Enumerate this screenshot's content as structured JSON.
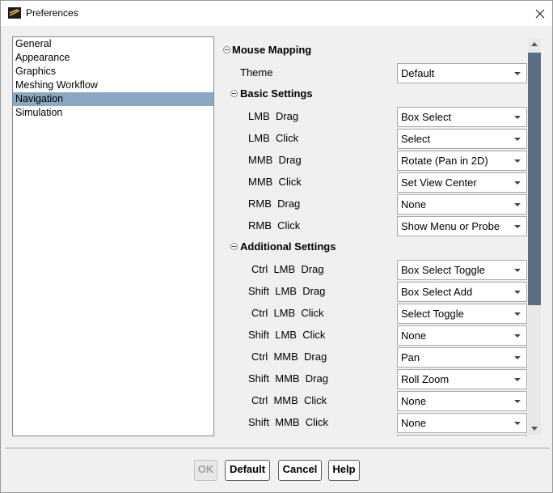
{
  "window": {
    "title": "Preferences"
  },
  "categories": [
    {
      "label": "General",
      "selected": false
    },
    {
      "label": "Appearance",
      "selected": false
    },
    {
      "label": "Graphics",
      "selected": false
    },
    {
      "label": "Meshing Workflow",
      "selected": false
    },
    {
      "label": "Navigation",
      "selected": true
    },
    {
      "label": "Simulation",
      "selected": false
    }
  ],
  "mouse_mapping": {
    "title": "Mouse Mapping",
    "theme_label": "Theme",
    "theme_value": "Default"
  },
  "basic_settings": {
    "title": "Basic Settings",
    "rows": [
      {
        "label": "LMB  Drag",
        "value": "Box Select"
      },
      {
        "label": "LMB  Click",
        "value": "Select"
      },
      {
        "label": "MMB  Drag",
        "value": "Rotate (Pan in 2D)"
      },
      {
        "label": "MMB  Click",
        "value": "Set View Center"
      },
      {
        "label": "RMB  Drag",
        "value": "None"
      },
      {
        "label": "RMB  Click",
        "value": "Show Menu or Probe"
      }
    ]
  },
  "additional_settings": {
    "title": "Additional Settings",
    "rows": [
      {
        "label": "Ctrl  LMB  Drag",
        "value": "Box Select Toggle"
      },
      {
        "label": "Shift  LMB  Drag",
        "value": "Box Select Add"
      },
      {
        "label": "Ctrl  LMB  Click",
        "value": "Select Toggle"
      },
      {
        "label": "Shift  LMB  Click",
        "value": "None"
      },
      {
        "label": "Ctrl  MMB  Drag",
        "value": "Pan"
      },
      {
        "label": "Shift  MMB  Drag",
        "value": "Roll Zoom"
      },
      {
        "label": "Ctrl  MMB  Click",
        "value": "None"
      },
      {
        "label": "Shift  MMB  Click",
        "value": "None"
      }
    ]
  },
  "buttons": {
    "ok": "OK",
    "default": "Default",
    "cancel": "Cancel",
    "help": "Help"
  },
  "colors": {
    "selection": "#8aa7c3",
    "scroll_thumb": "#5b6e82"
  },
  "icons": {
    "app": "app-logo-icon",
    "close": "close-icon",
    "collapse": "collapse-icon",
    "dropdown": "chevron-down-icon"
  }
}
